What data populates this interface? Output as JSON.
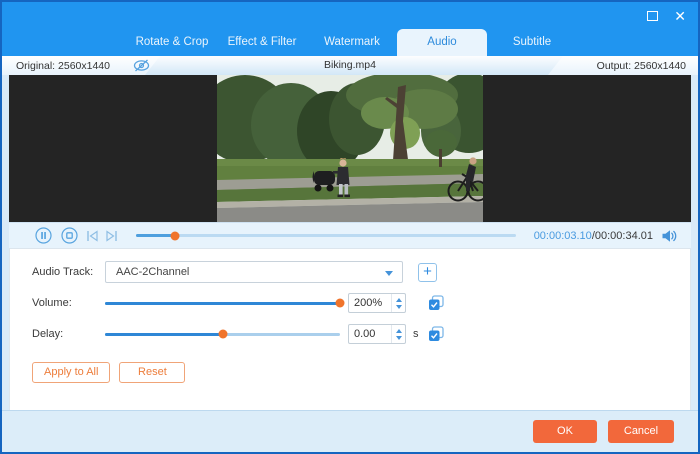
{
  "title_bar": {
    "maximize_icon": "",
    "close_icon": "✕"
  },
  "tabs": [
    {
      "label": "Rotate & Crop",
      "active": false
    },
    {
      "label": "Effect & Filter",
      "active": false
    },
    {
      "label": "Watermark",
      "active": false
    },
    {
      "label": "Audio",
      "active": true
    },
    {
      "label": "Subtitle",
      "active": false
    }
  ],
  "info_bar": {
    "original": "Original: 2560x1440",
    "filename": "Biking.mp4",
    "output": "Output: 2560x1440"
  },
  "player": {
    "current_time": "00:00:03.10",
    "time_separator": "/",
    "total_time": "00:00:34.01",
    "seek_percent": 10.4
  },
  "audio": {
    "track_label": "Audio Track:",
    "track_value": "AAC-2Channel",
    "add_track_label": "+",
    "volume_label": "Volume:",
    "volume_value": "200%",
    "volume_percent": 100,
    "delay_label": "Delay:",
    "delay_value": "0.00",
    "delay_unit": "s",
    "delay_percent": 50,
    "apply_all_label": "Apply to All",
    "reset_label": "Reset"
  },
  "footer": {
    "ok_label": "OK",
    "cancel_label": "Cancel"
  },
  "colors": {
    "accent_blue": "#2095F0",
    "active_tab_bg": "#E9F4FD",
    "accent_orange": "#F2683B",
    "slider_thumb_orange": "#F0742B",
    "slider_blue": "#2E87D6"
  }
}
